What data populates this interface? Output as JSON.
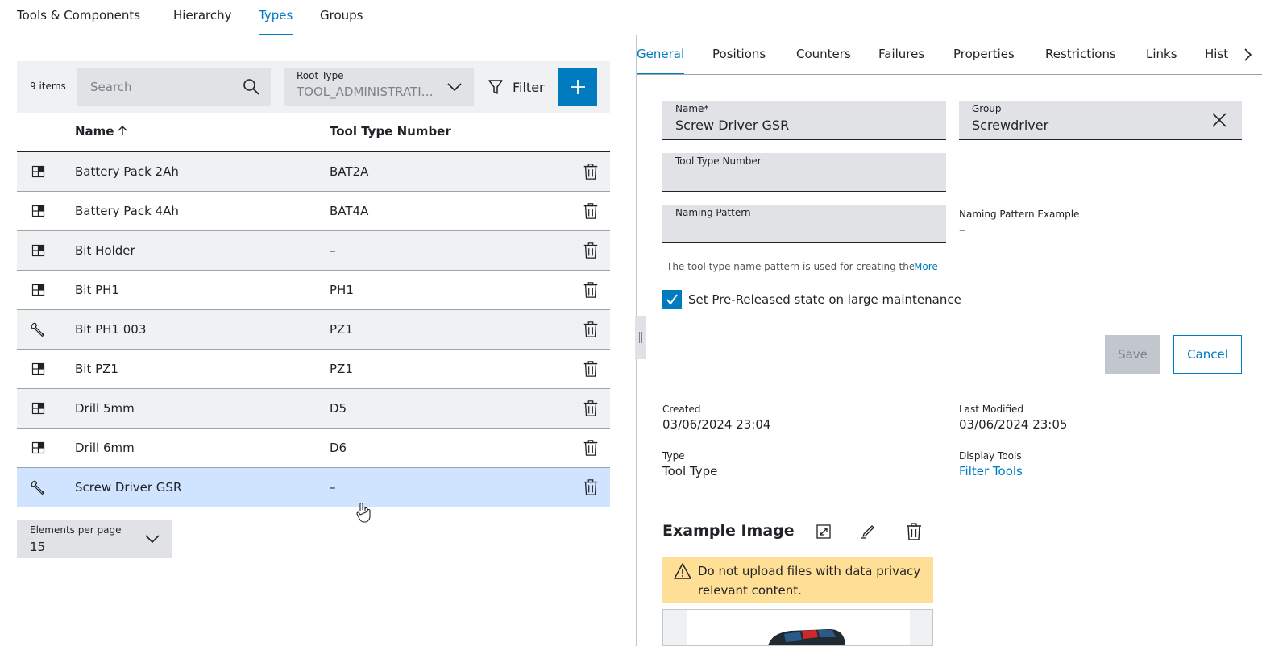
{
  "top_tabs": [
    {
      "label": "Tools & Components",
      "active": false
    },
    {
      "label": "Hierarchy",
      "active": false
    },
    {
      "label": "Types",
      "active": true
    },
    {
      "label": "Groups",
      "active": false
    }
  ],
  "toolbar": {
    "items_count": "9 items",
    "search_placeholder": "Search",
    "root_type_label": "Root Type",
    "root_type_value": "TOOL_ADMINISTRATION",
    "filter_label": "Filter",
    "add_icon": "plus-icon"
  },
  "table": {
    "columns": [
      "Name",
      "Tool Type Number"
    ],
    "sort": "ascending",
    "rows": [
      {
        "name": "Battery Pack 2Ah",
        "number": "BAT2A",
        "icon": "component-icon"
      },
      {
        "name": "Battery Pack 4Ah",
        "number": "BAT4A",
        "icon": "component-icon"
      },
      {
        "name": "Bit Holder",
        "number": "–",
        "icon": "component-icon"
      },
      {
        "name": "Bit PH1",
        "number": "PH1",
        "icon": "component-icon"
      },
      {
        "name": "Bit PH1 003",
        "number": "PZ1",
        "icon": "wrench-icon"
      },
      {
        "name": "Bit PZ1",
        "number": "PZ1",
        "icon": "component-icon"
      },
      {
        "name": "Drill 5mm",
        "number": "D5",
        "icon": "component-icon"
      },
      {
        "name": "Drill 6mm",
        "number": "D6",
        "icon": "component-icon"
      },
      {
        "name": "Screw Driver GSR",
        "number": "–",
        "icon": "wrench-icon",
        "selected": true
      }
    ]
  },
  "pagination": {
    "label": "Elements per page",
    "value": "15"
  },
  "detail_tabs": [
    "General",
    "Positions",
    "Counters",
    "Failures",
    "Properties",
    "Restrictions",
    "Links",
    "Hist"
  ],
  "form": {
    "name_label": "Name*",
    "name_value": "Screw Driver GSR",
    "group_label": "Group",
    "group_value": "Screwdriver",
    "tool_type_number_label": "Tool Type Number",
    "tool_type_number_value": "",
    "naming_pattern_label": "Naming Pattern",
    "naming_pattern_value": "",
    "naming_example_label": "Naming Pattern Example",
    "naming_example_value": "–",
    "hint": "The tool type name pattern is used for creating the tool names",
    "hint_more": "More",
    "checkbox_label": "Set Pre-Released state on large maintenance",
    "checkbox_checked": true,
    "save_label": "Save",
    "cancel_label": "Cancel"
  },
  "meta": {
    "created_label": "Created",
    "created_value": "03/06/2024 23:04",
    "modified_label": "Last Modified",
    "modified_value": "03/06/2024 23:05",
    "type_label": "Type",
    "type_value": "Tool Type",
    "display_label": "Display Tools",
    "display_value": "Filter Tools"
  },
  "example_image": {
    "title": "Example Image",
    "warning": "Do not upload files with data privacy relevant content."
  },
  "colors": {
    "accent": "#007bc0",
    "selected_row": "#d1e4ff",
    "warning": "#ffdf95"
  }
}
